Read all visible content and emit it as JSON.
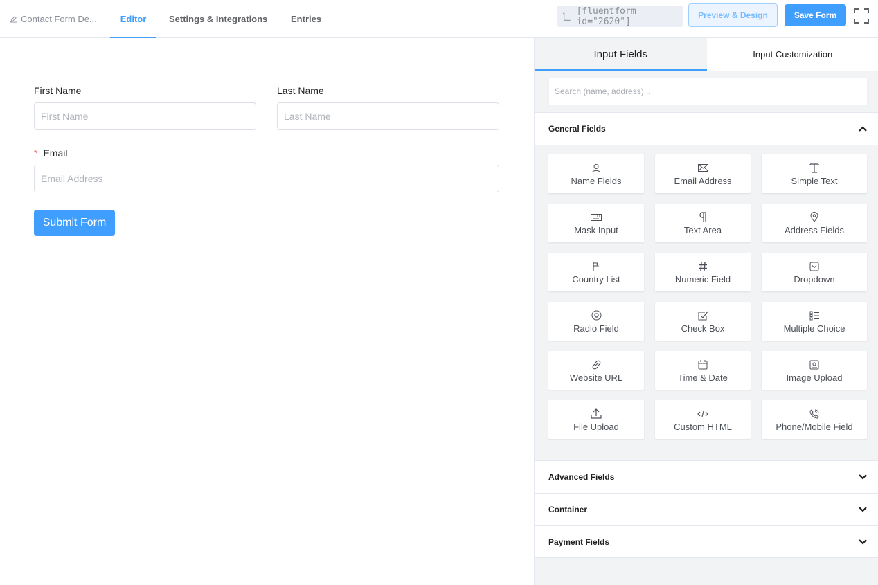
{
  "topbar": {
    "form_title": "Contact Form De...",
    "tabs": [
      {
        "label": "Editor"
      },
      {
        "label": "Settings & Integrations"
      },
      {
        "label": "Entries"
      }
    ],
    "shortcode": "[fluentform id=\"2620\"]",
    "preview_label": "Preview & Design",
    "save_label": "Save Form"
  },
  "form": {
    "first_name": {
      "label": "First Name",
      "placeholder": "First Name"
    },
    "last_name": {
      "label": "Last Name",
      "placeholder": "Last Name"
    },
    "email": {
      "required_mark": "*",
      "label": "Email",
      "placeholder": "Email Address"
    },
    "submit_label": "Submit Form"
  },
  "sidebar": {
    "tabs": [
      {
        "label": "Input Fields"
      },
      {
        "label": "Input Customization"
      }
    ],
    "search_placeholder": "Search (name, address)...",
    "sections": [
      {
        "label": "General Fields"
      },
      {
        "label": "Advanced Fields"
      },
      {
        "label": "Container"
      },
      {
        "label": "Payment Fields"
      }
    ],
    "fields": [
      {
        "label": "Name Fields",
        "icon": "user-icon"
      },
      {
        "label": "Email Address",
        "icon": "envelope-icon"
      },
      {
        "label": "Simple Text",
        "icon": "text-icon"
      },
      {
        "label": "Mask Input",
        "icon": "keyboard-icon"
      },
      {
        "label": "Text Area",
        "icon": "paragraph-icon"
      },
      {
        "label": "Address Fields",
        "icon": "map-pin-icon"
      },
      {
        "label": "Country List",
        "icon": "flag-icon"
      },
      {
        "label": "Numeric Field",
        "icon": "hash-icon"
      },
      {
        "label": "Dropdown",
        "icon": "dropdown-icon"
      },
      {
        "label": "Radio Field",
        "icon": "radio-icon"
      },
      {
        "label": "Check Box",
        "icon": "checkbox-icon"
      },
      {
        "label": "Multiple Choice",
        "icon": "list-icon"
      },
      {
        "label": "Website URL",
        "icon": "link-icon"
      },
      {
        "label": "Time & Date",
        "icon": "calendar-icon"
      },
      {
        "label": "Image Upload",
        "icon": "image-icon"
      },
      {
        "label": "File Upload",
        "icon": "upload-icon"
      },
      {
        "label": "Custom HTML",
        "icon": "code-icon"
      },
      {
        "label": "Phone/Mobile Field",
        "icon": "phone-icon"
      }
    ]
  },
  "colors": {
    "accent": "#409eff",
    "required": "#f56c6c",
    "sidebar_bg": "#f2f3f5"
  }
}
